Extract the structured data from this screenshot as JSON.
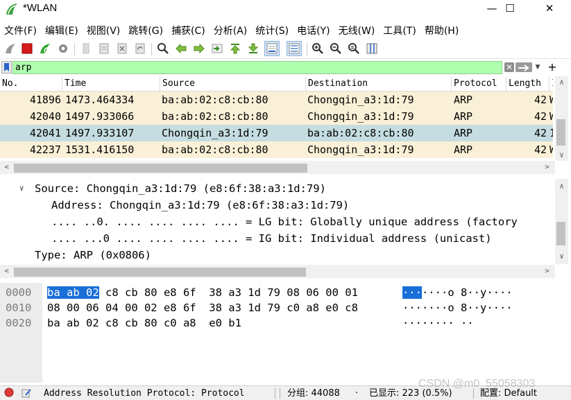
{
  "window": {
    "title": "*WLAN",
    "minimize": "—",
    "maximize": "☐",
    "close": "✕"
  },
  "menu": [
    "文件(F)",
    "编辑(E)",
    "视图(V)",
    "跳转(G)",
    "捕获(C)",
    "分析(A)",
    "统计(S)",
    "电话(Y)",
    "无线(W)",
    "工具(T)",
    "帮助(H)"
  ],
  "filter": {
    "value": "arp",
    "background": "#afffaf"
  },
  "packet_list": {
    "columns": [
      "No.",
      "Time",
      "Source",
      "Destination",
      "Protocol",
      "Length",
      "I"
    ],
    "rows": [
      {
        "no": "41896",
        "time": "1473.464334",
        "source": "ba:ab:02:c8:cb:80",
        "destination": "Chongqin_a3:1d:79",
        "protocol": "ARP",
        "length": "42",
        "info": "W",
        "selected": false
      },
      {
        "no": "42040",
        "time": "1497.933066",
        "source": "ba:ab:02:c8:cb:80",
        "destination": "Chongqin_a3:1d:79",
        "protocol": "ARP",
        "length": "42",
        "info": "W",
        "selected": false
      },
      {
        "no": "42041",
        "time": "1497.933107",
        "source": "Chongqin_a3:1d:79",
        "destination": "ba:ab:02:c8:cb:80",
        "protocol": "ARP",
        "length": "42",
        "info": "1",
        "selected": true
      },
      {
        "no": "42237",
        "time": "1531.416150",
        "source": "ba:ab:02:c8:cb:80",
        "destination": "Chongqin_a3:1d:79",
        "protocol": "ARP",
        "length": "42",
        "info": "W",
        "selected": false
      }
    ],
    "row_color": "#faf0d7",
    "selected_color": "#c5dde0"
  },
  "details": {
    "source_line": "Source: Chongqin_a3:1d:79 (e8:6f:38:a3:1d:79)",
    "address_line": "Address: Chongqin_a3:1d:79 (e8:6f:38:a3:1d:79)",
    "lg_bit_line": ".... ..0. .... .... .... .... = LG bit: Globally unique address (factory",
    "ig_bit_line": ".... ...0 .... .... .... .... = IG bit: Individual address (unicast)",
    "type_line": "Type: ARP (0x0806)"
  },
  "bytes": [
    {
      "offset": "0000",
      "hex_highlight": "ba ab 02",
      "hex_rest": " c8 cb 80 e8 6f  38 a3 1d 79 08 06 00 01",
      "ascii_highlight": "···",
      "ascii_rest": "····o 8··y····"
    },
    {
      "offset": "0010",
      "hex_highlight": "",
      "hex_rest": "08 00 06 04 00 02 e8 6f  38 a3 1d 79 c0 a8 e0 c8",
      "ascii_highlight": "",
      "ascii_rest": "·······o 8··y····"
    },
    {
      "offset": "0020",
      "hex_highlight": "",
      "hex_rest": "ba ab 02 c8 cb 80 c0 a8  e0 b1",
      "ascii_highlight": "",
      "ascii_rest": "········ ··"
    }
  ],
  "status": {
    "field_desc": "Address Resolution Protocol: Protocol",
    "packets": "分组: 44088",
    "displayed": "已显示: 223 (0.5%)",
    "profile": "配置: Default"
  },
  "watermark": "CSDN @m0_55058303"
}
